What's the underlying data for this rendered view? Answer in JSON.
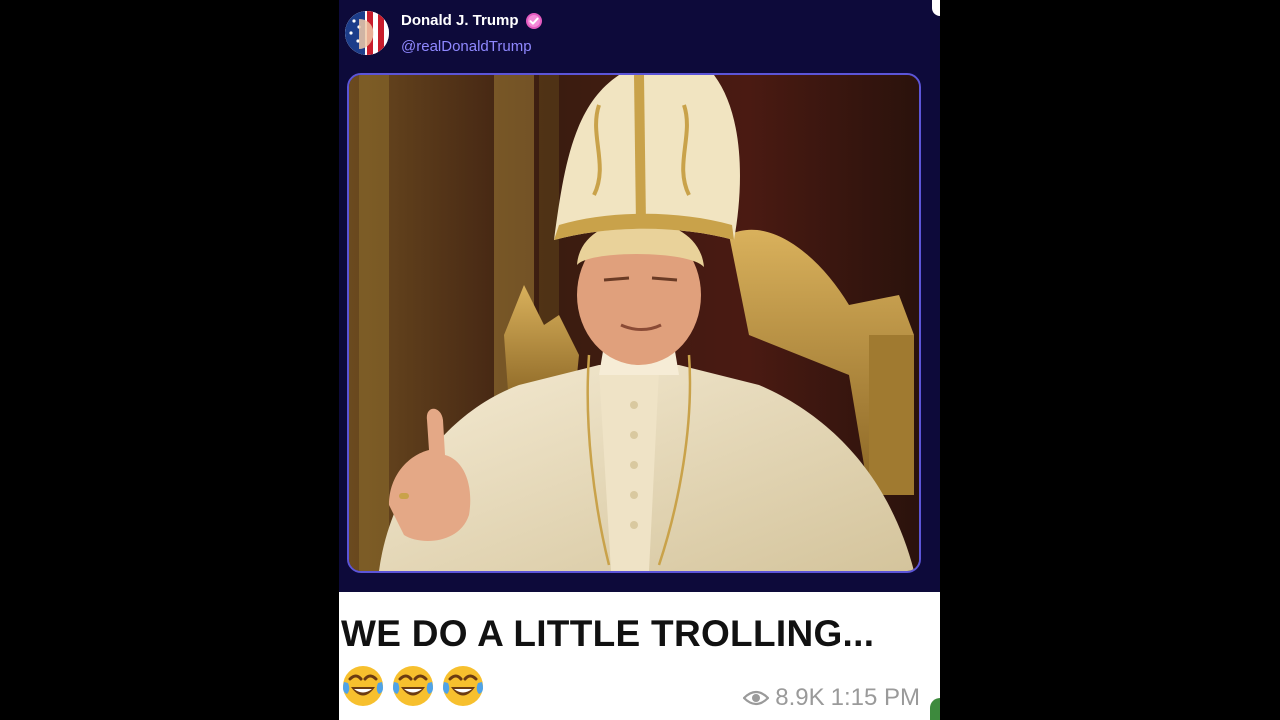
{
  "post": {
    "author_name": "Donald J. Trump",
    "handle": "@realDonaldTrump",
    "image_icon": "pope-portrait-image"
  },
  "caption": {
    "text": "WE DO A LITTLE TROLLING...",
    "emojis": [
      "😂",
      "😂",
      "😂"
    ]
  },
  "meta": {
    "views": "8.9K",
    "time": "1:15 PM"
  },
  "colors": {
    "post_background": "#0d0a3a",
    "handle": "#8f88ff",
    "image_border": "#5c55d8",
    "caption_text": "#111111",
    "meta_text": "#9a9a9a"
  }
}
